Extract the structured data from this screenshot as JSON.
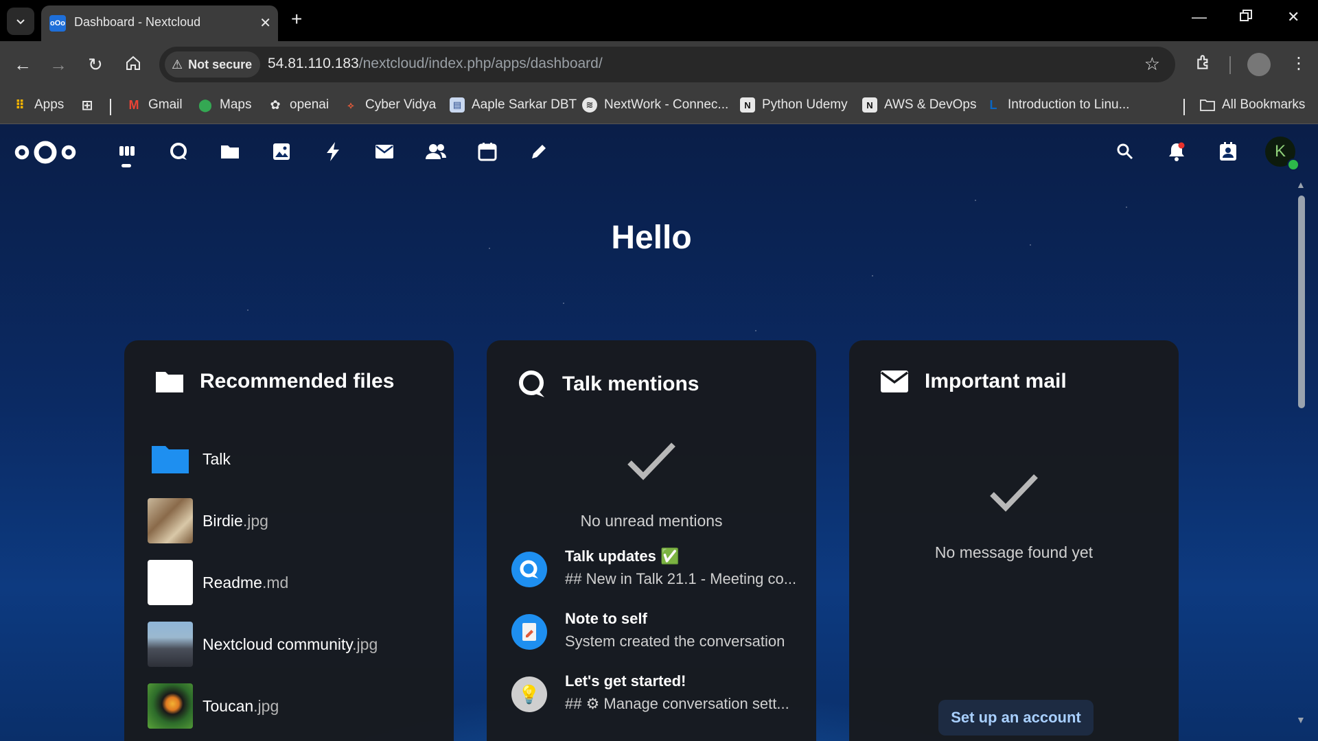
{
  "browser": {
    "tab_title": "Dashboard - Nextcloud",
    "security_label": "Not secure",
    "url_host": "54.81.110.183",
    "url_path": "/nextcloud/index.php/apps/dashboard/",
    "bookmarks": [
      {
        "label": "Apps",
        "icon": "apps-grid-icon"
      },
      {
        "label": "",
        "icon": "grid-icon"
      },
      {
        "label": "Gmail",
        "icon": "gmail-icon"
      },
      {
        "label": "Maps",
        "icon": "maps-pin-icon"
      },
      {
        "label": "openai",
        "icon": "openai-icon"
      },
      {
        "label": "Cyber Vidya",
        "icon": "cyber-vidya-icon"
      },
      {
        "label": "Aaple Sarkar DBT",
        "icon": "document-icon"
      },
      {
        "label": "NextWork - Connec...",
        "icon": "nextwork-icon"
      },
      {
        "label": "Python Udemy",
        "icon": "notion-icon"
      },
      {
        "label": "AWS & DevOps",
        "icon": "notion-icon"
      },
      {
        "label": "Introduction to Linu...",
        "icon": "linkedin-learning-icon"
      }
    ],
    "all_bookmarks_label": "All Bookmarks"
  },
  "nextcloud": {
    "header_apps": [
      "dashboard-icon",
      "talk-icon",
      "files-icon",
      "photos-icon",
      "activity-icon",
      "mail-icon",
      "contacts-icon",
      "calendar-icon",
      "notes-icon"
    ],
    "avatar_letter": "K",
    "greeting": "Hello",
    "recommended": {
      "title": "Recommended files",
      "files": [
        {
          "name": "Talk",
          "ext": "",
          "type": "folder"
        },
        {
          "name": "Birdie",
          "ext": ".jpg",
          "type": "image"
        },
        {
          "name": "Readme",
          "ext": ".md",
          "type": "doc"
        },
        {
          "name": "Nextcloud community",
          "ext": ".jpg",
          "type": "image"
        },
        {
          "name": "Toucan",
          "ext": ".jpg",
          "type": "image"
        }
      ]
    },
    "talk": {
      "title": "Talk mentions",
      "empty_text": "No unread mentions",
      "conversations": [
        {
          "title": "Talk updates",
          "badge": "✅",
          "subtitle": "## New in Talk 21.1 - Meeting co..."
        },
        {
          "title": "Note to self",
          "badge": "",
          "subtitle": "System created the conversation"
        },
        {
          "title": "Let's get started!",
          "badge": "",
          "subtitle": "## ⚙ Manage conversation sett..."
        }
      ]
    },
    "mail": {
      "title": "Important mail",
      "empty_text": "No message found yet",
      "setup_label": "Set up an account"
    }
  }
}
